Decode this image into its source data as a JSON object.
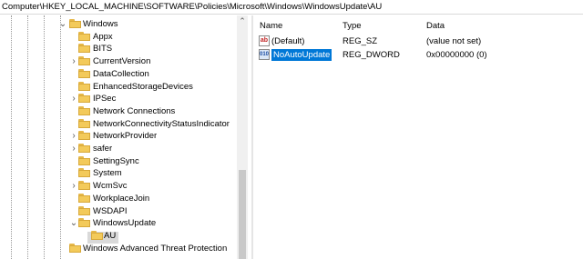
{
  "address": "Computer\\HKEY_LOCAL_MACHINE\\SOFTWARE\\Policies\\Microsoft\\Windows\\WindowsUpdate\\AU",
  "tree": {
    "items": [
      {
        "label": "Windows",
        "chevron": "v",
        "level": 0
      },
      {
        "label": "Appx",
        "chevron": "",
        "level": 1
      },
      {
        "label": "BITS",
        "chevron": "",
        "level": 1
      },
      {
        "label": "CurrentVersion",
        "chevron": ">",
        "level": 1
      },
      {
        "label": "DataCollection",
        "chevron": "",
        "level": 1
      },
      {
        "label": "EnhancedStorageDevices",
        "chevron": "",
        "level": 1
      },
      {
        "label": "IPSec",
        "chevron": ">",
        "level": 1
      },
      {
        "label": "Network Connections",
        "chevron": "",
        "level": 1
      },
      {
        "label": "NetworkConnectivityStatusIndicator",
        "chevron": "",
        "level": 1
      },
      {
        "label": "NetworkProvider",
        "chevron": ">",
        "level": 1
      },
      {
        "label": "safer",
        "chevron": ">",
        "level": 1
      },
      {
        "label": "SettingSync",
        "chevron": "",
        "level": 1
      },
      {
        "label": "System",
        "chevron": "",
        "level": 1
      },
      {
        "label": "WcmSvc",
        "chevron": ">",
        "level": 1
      },
      {
        "label": "WorkplaceJoin",
        "chevron": "",
        "level": 1
      },
      {
        "label": "WSDAPI",
        "chevron": "",
        "level": 1
      },
      {
        "label": "WindowsUpdate",
        "chevron": "v",
        "level": 1
      },
      {
        "label": "AU",
        "chevron": "",
        "level": 2
      },
      {
        "label": "Windows Advanced Threat Protection",
        "chevron": "",
        "level": 0
      }
    ]
  },
  "values_pane": {
    "columns": {
      "name": "Name",
      "type": "Type",
      "data": "Data"
    },
    "rows": [
      {
        "name": "(Default)",
        "type": "REG_SZ",
        "data": "(value not set)",
        "icon": "string-value-icon"
      },
      {
        "name": "NoAutoUpdate",
        "type": "REG_DWORD",
        "data": "0x00000000 (0)",
        "icon": "dword-value-icon"
      }
    ]
  },
  "colors": {
    "selection": "#0078d7",
    "folder": "#f3ca5a"
  }
}
